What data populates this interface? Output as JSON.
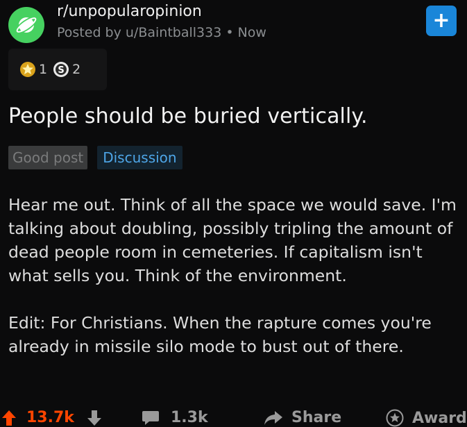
{
  "post": {
    "subreddit": "r/unpopularopinion",
    "posted_by": "Posted by u/Baintball333",
    "separator": "•",
    "time": "Now",
    "join_label": "+",
    "awards": [
      {
        "icon": "gold-award-icon",
        "count": "1"
      },
      {
        "icon": "silver-award-icon",
        "count": "2"
      }
    ],
    "title": "People should be buried vertically.",
    "flairs": {
      "user": "Good post",
      "post": "Discussion"
    },
    "body": [
      "Hear me out. Think of all the space we would save. I'm talking about doubling, possibly tripling the amount of dead people room in cemeteries. If capitalism isn't what sells you. Think of the environment.",
      "Edit: For Christians. When the rapture comes you're already in missile silo mode to bust out of there."
    ],
    "actions": {
      "upvotes": "13.7k",
      "comments": "1.3k",
      "share": "Share",
      "award": "Award"
    }
  },
  "colors": {
    "background": "#0b0b0c",
    "upvote": "#ff4500",
    "join_button": "#1a86d9",
    "flair_discussion": "#4ea6e8",
    "subreddit_avatar": "#46d160"
  }
}
